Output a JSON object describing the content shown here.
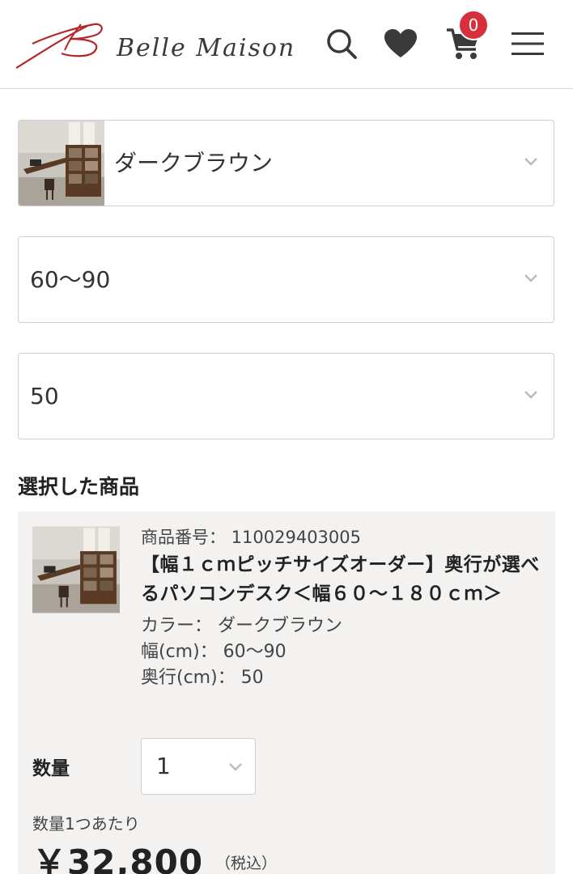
{
  "header": {
    "brand": "Belle Maison",
    "cart_count": "0",
    "icons": [
      "search-icon",
      "heart-icon",
      "cart-icon",
      "menu-icon"
    ]
  },
  "options": {
    "color": "ダークブラウン",
    "width": "60〜90",
    "depth": "50"
  },
  "selected": {
    "title": "選択した商品",
    "product_no": "商品番号： 110029403005",
    "name": "【幅１ｃｍピッチサイズオーダー】奥行が選べるパソコンデスク＜幅６０〜１８０ｃｍ＞",
    "color": "カラー： ダークブラウン",
    "width": "幅(cm)： 60〜90",
    "depth": "奥行(cm)： 50",
    "qty_label": "数量",
    "qty_value": "1",
    "per_unit": "数量1つあたり",
    "price": "￥32,800",
    "tax": "（税込）"
  },
  "colors": {
    "badge": "#d6313b",
    "logo": "#b5252b",
    "panel": "#f3f2f0"
  }
}
